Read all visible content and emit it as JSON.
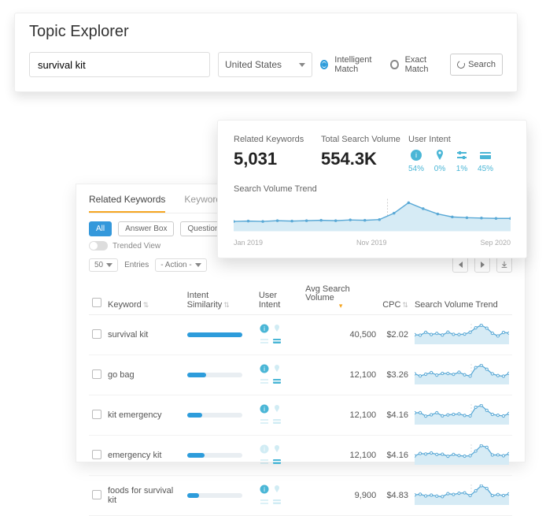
{
  "top": {
    "title": "Topic Explorer",
    "search_value": "survival kit",
    "country": "United States",
    "match_intelligent": "Intelligent Match",
    "match_exact": "Exact Match",
    "match_selected": "intelligent",
    "search_button": "Search"
  },
  "summary": {
    "related_label": "Related Keywords",
    "related_value": "5,031",
    "volume_label": "Total Search Volume",
    "volume_value": "554.3K",
    "intent_label": "User Intent",
    "intent": {
      "info_pct": "54%",
      "nav_pct": "0%",
      "comp_pct": "1%",
      "trans_pct": "45%"
    },
    "trend_label": "Search Volume Trend",
    "months": {
      "a": "Jan 2019",
      "b": "Nov 2019",
      "c": "Sep 2020"
    }
  },
  "panel": {
    "tabs": {
      "related": "Related Keywords",
      "pattern": "Keyword Pattern"
    },
    "filters": {
      "all": "All",
      "answer": "Answer Box",
      "questions": "Questions"
    },
    "trended_label": "Trended View",
    "entries_size": "50",
    "entries_label": "Entries",
    "action_label": "- Action -",
    "columns": {
      "keyword": "Keyword",
      "intent_sim": "Intent Similarity",
      "user_intent": "User Intent",
      "avg_vol": "Avg Search Volume",
      "cpc": "CPC",
      "trend": "Search Volume Trend"
    },
    "rows": [
      {
        "kw": "survival kit",
        "sim": 100,
        "vol": "40,500",
        "cpc": "$2.02",
        "info": true,
        "trans": true
      },
      {
        "kw": "go bag",
        "sim": 35,
        "vol": "12,100",
        "cpc": "$3.26",
        "info": true,
        "trans": true
      },
      {
        "kw": "kit emergency",
        "sim": 28,
        "vol": "12,100",
        "cpc": "$4.16",
        "info": true,
        "trans": false
      },
      {
        "kw": "emergency kit",
        "sim": 32,
        "vol": "12,100",
        "cpc": "$4.16",
        "info": false,
        "trans": true
      },
      {
        "kw": "foods for survival kit",
        "sim": 22,
        "vol": "9,900",
        "cpc": "$4.83",
        "info": true,
        "trans": false
      }
    ]
  },
  "chart_data": {
    "type": "line",
    "title": "Search Volume Trend",
    "x_labels": [
      "Jan 2019",
      "Nov 2019",
      "Sep 2020"
    ],
    "series": [
      {
        "name": "volume",
        "values": [
          18,
          19,
          18,
          20,
          19,
          20,
          21,
          20,
          22,
          21,
          23,
          40,
          68,
          52,
          38,
          30,
          28,
          27,
          26,
          26
        ]
      }
    ],
    "ylim": [
      0,
      70
    ]
  }
}
